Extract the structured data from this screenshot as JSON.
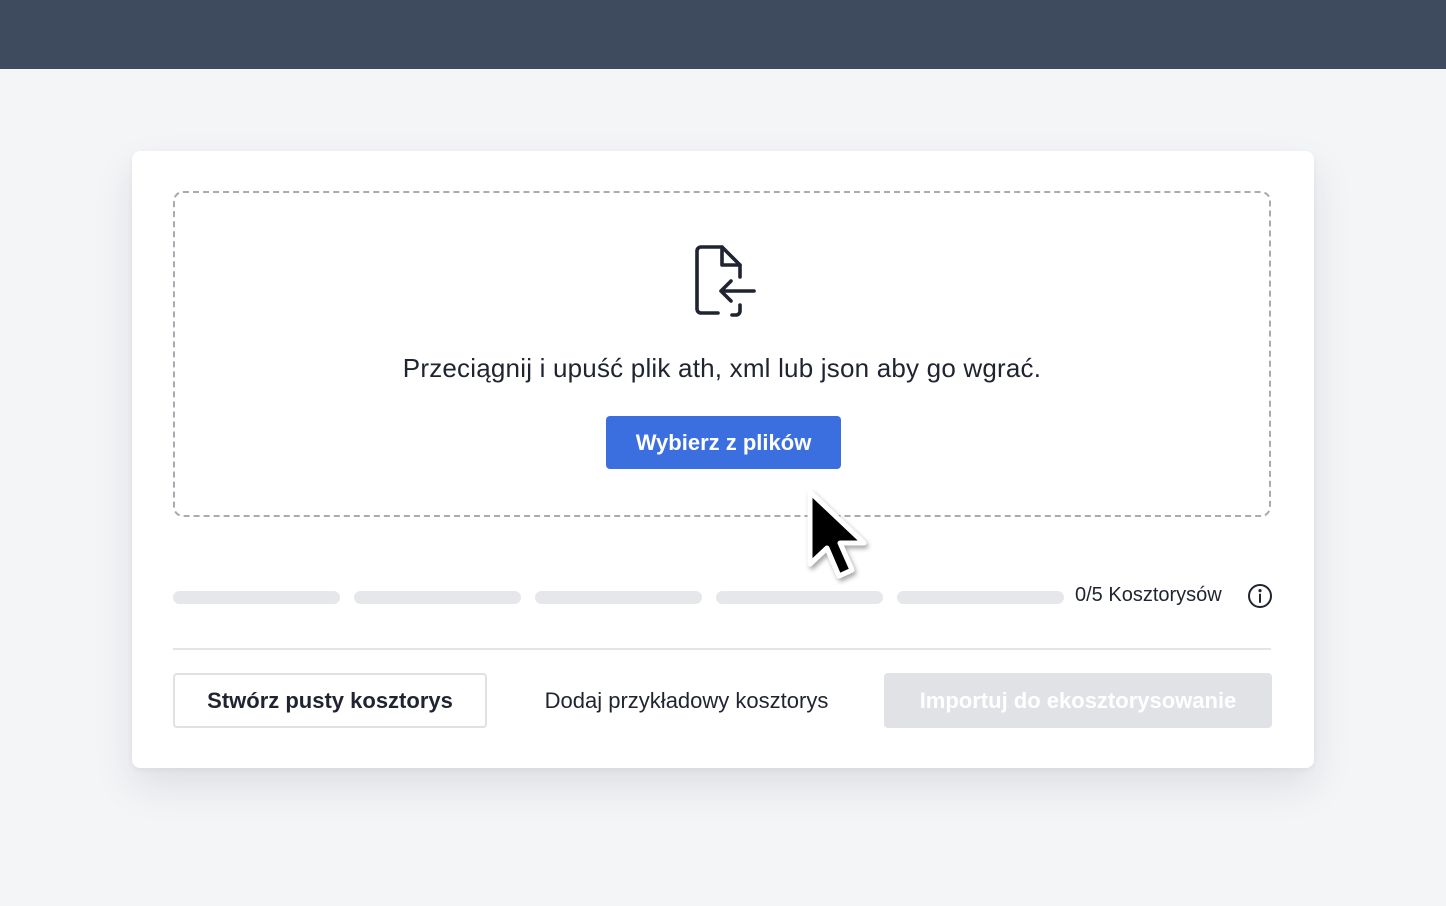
{
  "upload": {
    "icon": "file-import-icon",
    "instruction": "Przeciągnij i upuść plik ath, xml lub json aby go wgrać.",
    "choose_button": "Wybierz z plików"
  },
  "progress": {
    "segments_total": 5,
    "segments_filled": 0,
    "count_label": "0/5 Kosztorysów",
    "info_icon": "info-icon"
  },
  "actions": {
    "create_empty": "Stwórz pusty kosztorys",
    "add_sample": "Dodaj przykładowy kosztorys",
    "import": "Importuj do ekosztorysowanie"
  },
  "colors": {
    "topbar": "#3e4a5e",
    "primary": "#3b6fe0",
    "disabled": "#e1e2e5",
    "segment_empty": "#e6e7ea"
  }
}
